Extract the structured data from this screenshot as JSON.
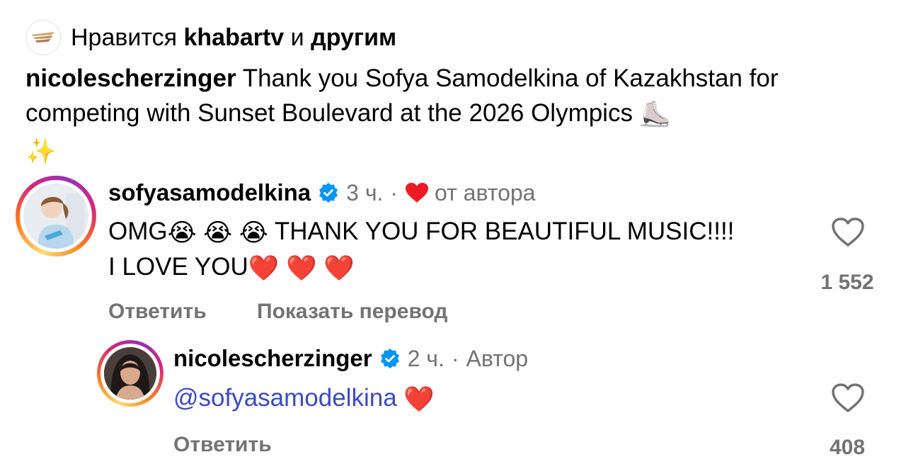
{
  "likes": {
    "prefix": "Нравится",
    "user": "khabartv",
    "middle": "и",
    "others": "другим"
  },
  "post": {
    "author": "nicolescherzinger",
    "caption": "Thank you Sofya Samodelkina of Kazakhstan for competing with Sunset Boulevard at the 2026 Olympics",
    "caption_emojis": [
      "⛸️",
      "✨"
    ]
  },
  "comments": [
    {
      "username": "sofyasamodelkina",
      "time": "3 ч.",
      "separator": "·",
      "author_liked_label": "от автора",
      "text_prefix": "OMG",
      "text_crying_emojis": [
        "😭",
        "😭",
        "😭"
      ],
      "text_main": "THANK YOU FOR BEAUTIFUL MUSIC!!!! I LOVE YOU",
      "text_heart_emojis": [
        "❤️",
        "❤️",
        "❤️"
      ],
      "like_count": "1 552",
      "reply_label": "Ответить",
      "translate_label": "Показать перевод"
    },
    {
      "username": "nicolescherzinger",
      "time": "2 ч.",
      "separator": "·",
      "author_badge": "Автор",
      "mention": "@sofyasamodelkina",
      "text_heart_emojis": [
        "❤️"
      ],
      "like_count": "408",
      "reply_label": "Ответить"
    }
  ],
  "colors": {
    "verified": "#0095f6",
    "heart_red": "#ed1c24",
    "meta_gray": "#737373",
    "mention_blue": "#3a4ac7"
  },
  "icons": {
    "liker_avatar": "khabar-logo-icon",
    "verified": "verified-badge-icon",
    "like_outline": "heart-outline-icon",
    "author_like": "red-heart-icon"
  }
}
